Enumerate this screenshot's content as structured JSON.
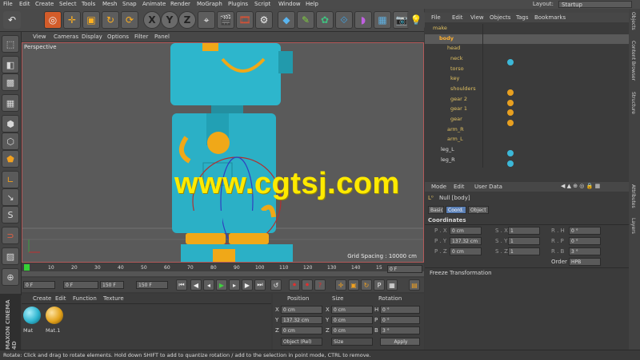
{
  "menubar": [
    "File",
    "Edit",
    "Create",
    "Select",
    "Tools",
    "Mesh",
    "Snap",
    "Animate",
    "Render",
    "MoGraph",
    "Plugins",
    "Script",
    "Window",
    "Help"
  ],
  "layout": {
    "label": "Layout:",
    "value": "Startup"
  },
  "viewport_menu": [
    "View",
    "Cameras",
    "Display",
    "Options",
    "Filter",
    "Panel"
  ],
  "viewport": {
    "label": "Perspective",
    "grid_spacing": "Grid Spacing : 10000 cm",
    "watermark": "www.cgtsj.com"
  },
  "timeline": {
    "ticks": [
      "0",
      "10",
      "20",
      "30",
      "40",
      "50",
      "60",
      "70",
      "80",
      "90",
      "100",
      "110",
      "120",
      "130",
      "140",
      "15"
    ],
    "end_field": "0 F"
  },
  "transport": {
    "start": "0 F",
    "range_start": "0 F",
    "range_end": "150 F",
    "end": "150 F"
  },
  "materials": {
    "menu": [
      "Create",
      "Edit",
      "Function",
      "Texture"
    ],
    "items": [
      "Mat",
      "Mat.1"
    ],
    "colors": [
      "#2fb5d0",
      "#e3a21a"
    ]
  },
  "coords": {
    "headers": [
      "Position",
      "Size",
      "Rotation"
    ],
    "rows": [
      {
        "axis": "X",
        "pos": "0 cm",
        "size_axis": "X",
        "size": "0 cm",
        "rot_axis": "H",
        "rot": "0 °"
      },
      {
        "axis": "Y",
        "pos": "137.32 cm",
        "size_axis": "Y",
        "size": "0 cm",
        "rot_axis": "P",
        "rot": "0 °"
      },
      {
        "axis": "Z",
        "pos": "0 cm",
        "size_axis": "Z",
        "size": "0 cm",
        "rot_axis": "B",
        "rot": "3 °"
      }
    ],
    "mode": "Object (Rel)",
    "size_mode": "Size",
    "apply": "Apply"
  },
  "logo": "MAXON CINEMA 4D",
  "status": "Rotate: Click and drag to rotate elements. Hold down SHIFT to add to quantize rotation / add to the selection in point mode, CTRL to remove.",
  "object_menu": [
    "File",
    "Edit",
    "View",
    "Objects",
    "Tags",
    "Bookmarks"
  ],
  "objects": [
    {
      "name": "make",
      "indent": 0
    },
    {
      "name": "body",
      "indent": 1
    },
    {
      "name": "head",
      "indent": 2
    },
    {
      "name": "neck",
      "indent": 2
    },
    {
      "name": "torso",
      "indent": 2
    },
    {
      "name": "key",
      "indent": 2
    },
    {
      "name": "shoulders",
      "indent": 2
    },
    {
      "name": "gear 2",
      "indent": 2
    },
    {
      "name": "gear 1",
      "indent": 2
    },
    {
      "name": "gear",
      "indent": 2
    },
    {
      "name": "arm_R",
      "indent": 2
    },
    {
      "name": "arm_L",
      "indent": 2
    },
    {
      "name": "leg_L",
      "indent": 1
    },
    {
      "name": "leg_R",
      "indent": 1
    }
  ],
  "attributes": {
    "menu": [
      "Mode",
      "Edit",
      "User Data"
    ],
    "title": "Null [body]",
    "tabs": [
      "Basic",
      "Coord.",
      "Object"
    ],
    "section": "Coordinates",
    "rows": [
      {
        "p_label": "P . X",
        "p": "0 cm",
        "s_label": "S . X",
        "s": "1",
        "r_label": "R . H",
        "r": "0 °"
      },
      {
        "p_label": "P . Y",
        "p": "137.32 cm",
        "s_label": "S . Y",
        "s": "1",
        "r_label": "R . P",
        "r": "0 °"
      },
      {
        "p_label": "P . Z",
        "p": "0 cm",
        "s_label": "S . Z",
        "s": "1",
        "r_label": "R . B",
        "r": "3 °"
      }
    ],
    "order_label": "Order",
    "order": "HPB",
    "freeze": "Freeze Transformation"
  },
  "right_tabs": [
    "Objects",
    "Content Browser",
    "Structure",
    "Attributes",
    "Layers"
  ]
}
